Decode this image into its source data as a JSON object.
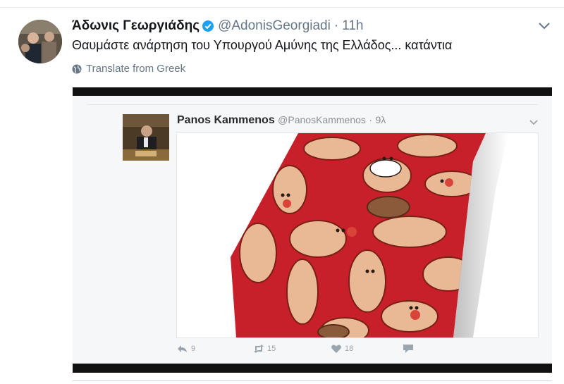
{
  "tweet": {
    "author_name": "Άδωνις Γεωργιάδης",
    "handle": "@AdonisGeorgiadi",
    "separator": "·",
    "time": "11h",
    "text": "Θαυμάστε ανάρτηση του Υπουργού Αμύνης της Ελλάδος... κατάντια",
    "translate_label": "Translate from Greek",
    "icons": [
      "verified-badge-icon",
      "chevron-down-icon",
      "globe-icon"
    ],
    "colors": {
      "verified": "#1da1f2",
      "secondary_text": "#657786"
    }
  },
  "embedded": {
    "author_name": "Panos Kammenos",
    "handle": "@PanosKammenos",
    "separator": "·",
    "time": "9λ",
    "actions": {
      "reply_count": "9",
      "retweet_count": "15",
      "like_count": "18"
    },
    "icons": [
      "reply-icon",
      "retweet-icon",
      "heart-icon",
      "direct-message-icon"
    ],
    "image_colors": {
      "background": "#c8202a",
      "shape": "#e9b895",
      "outline": "#7a1f16"
    }
  }
}
